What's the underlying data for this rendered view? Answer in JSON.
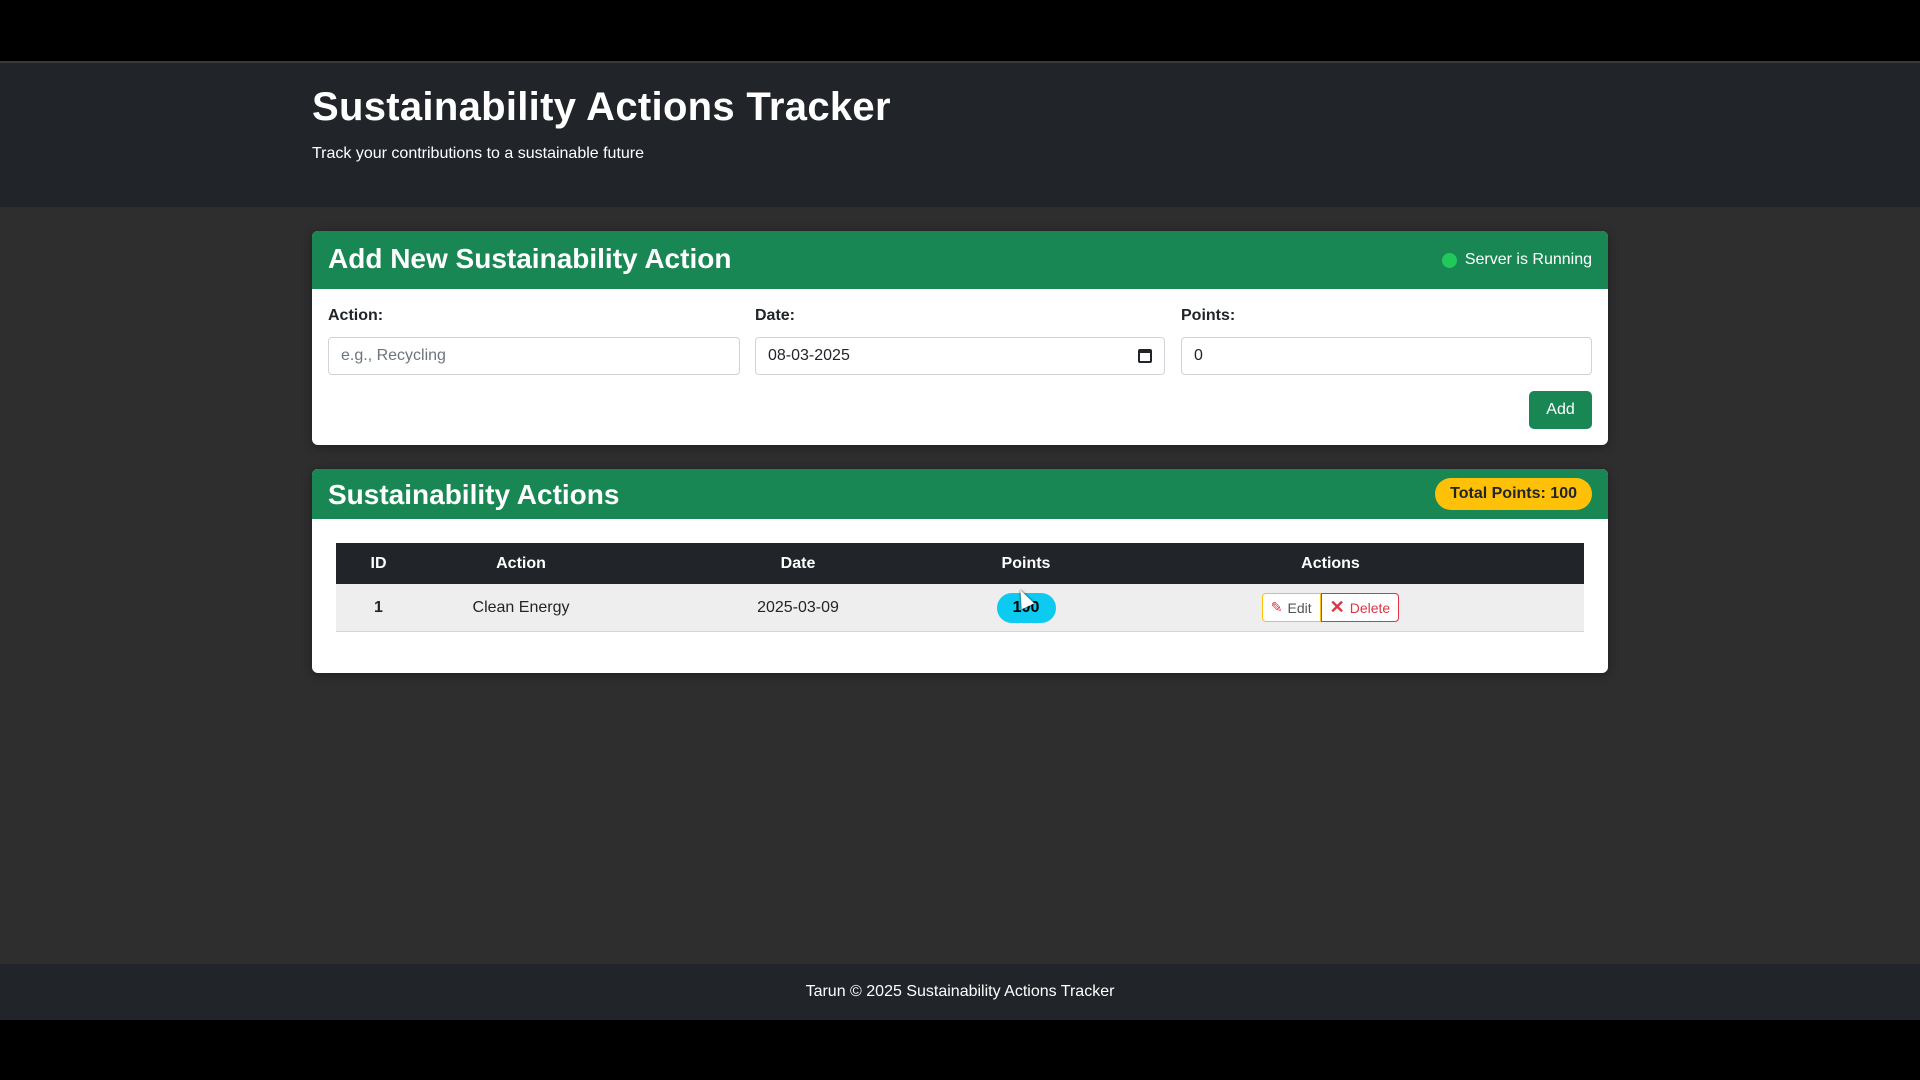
{
  "header": {
    "title": "Sustainability Actions Tracker",
    "subtitle": "Track your contributions to a sustainable future"
  },
  "form_card": {
    "title": "Add New Sustainability Action",
    "status_text": "Server is Running",
    "action_label": "Action:",
    "action_placeholder": "e.g., Recycling",
    "date_label": "Date:",
    "date_value": "08-03-2025",
    "points_label": "Points:",
    "points_value": "0",
    "add_label": "Add"
  },
  "list_card": {
    "title": "Sustainability Actions",
    "total_points": "Total Points: 100",
    "columns": [
      "ID",
      "Action",
      "Date",
      "Points",
      "Actions"
    ],
    "rows": [
      {
        "id": "1",
        "action": "Clean Energy",
        "date": "2025-03-09",
        "points": "100"
      }
    ],
    "edit_label": "Edit",
    "delete_label": "Delete"
  },
  "footer": {
    "text": "Tarun © 2025 Sustainability Actions Tracker"
  },
  "colors": {
    "header_bg": "#212529",
    "card_header": "#198754",
    "total_badge": "#ffc107",
    "points_pill": "#0dcaf0",
    "status_dot": "#20c95a"
  }
}
